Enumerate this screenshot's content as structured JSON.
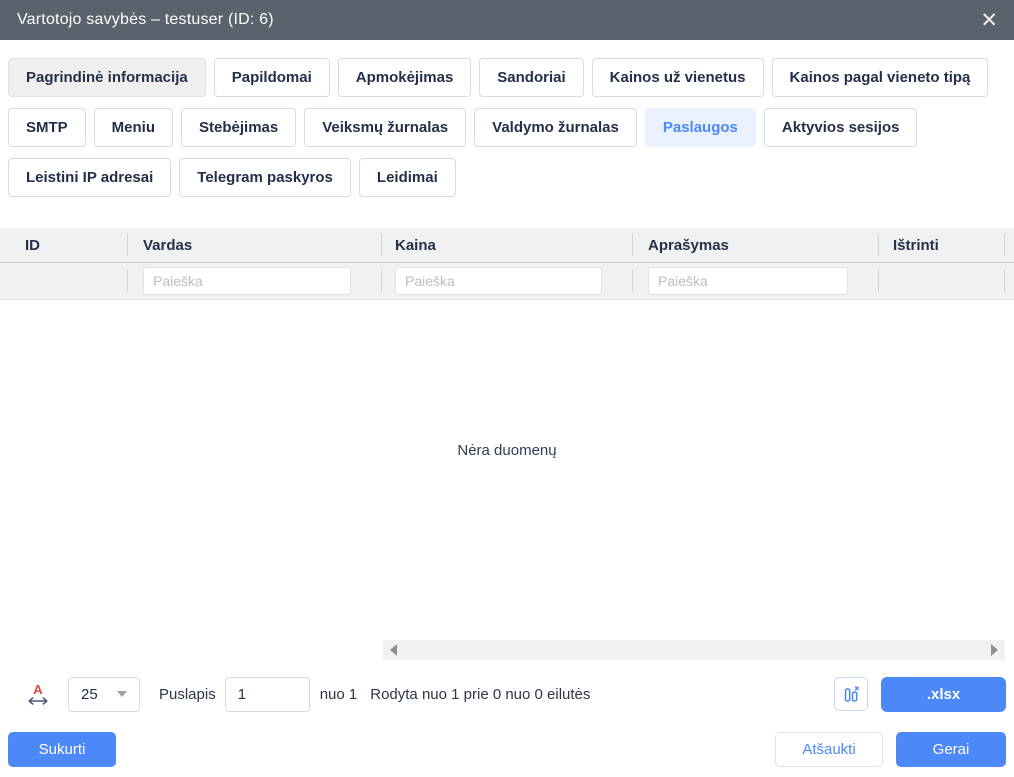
{
  "colors": {
    "accent": "#4d88f8",
    "titlebar_bg": "#5a626d",
    "active_tab_bg": "#e9f1fe",
    "active_tab_text": "#4e88f7",
    "table_header_bg": "#f0f1f3"
  },
  "titlebar": {
    "title": "Vartotojo savybės – testuser (ID: 6)",
    "close_icon": "✕"
  },
  "tabs": {
    "items": [
      {
        "label": "Pagrindinė informacija",
        "state": "pressed"
      },
      {
        "label": "Papildomai",
        "state": "normal"
      },
      {
        "label": "Apmokėjimas",
        "state": "normal"
      },
      {
        "label": "Sandoriai",
        "state": "normal"
      },
      {
        "label": "Kainos už vienetus",
        "state": "normal"
      },
      {
        "label": "Kainos pagal vieneto tipą",
        "state": "normal"
      },
      {
        "label": "SMTP",
        "state": "normal"
      },
      {
        "label": "Meniu",
        "state": "normal"
      },
      {
        "label": "Stebėjimas",
        "state": "normal"
      },
      {
        "label": "Veiksmų žurnalas",
        "state": "normal"
      },
      {
        "label": "Valdymo žurnalas",
        "state": "normal"
      },
      {
        "label": "Paslaugos",
        "state": "active"
      },
      {
        "label": "Aktyvios sesijos",
        "state": "normal"
      },
      {
        "label": "Leistini IP adresai",
        "state": "normal"
      },
      {
        "label": "Telegram paskyros",
        "state": "normal"
      },
      {
        "label": "Leidimai",
        "state": "normal"
      }
    ]
  },
  "table": {
    "columns": [
      {
        "label": "ID",
        "has_filter": false
      },
      {
        "label": "Vardas",
        "has_filter": true,
        "placeholder": "Paieška"
      },
      {
        "label": "Kaina",
        "has_filter": true,
        "placeholder": "Paieška"
      },
      {
        "label": "Aprašymas",
        "has_filter": true,
        "placeholder": "Paieška"
      },
      {
        "label": "Ištrinti",
        "has_filter": false
      }
    ],
    "empty_text": "Nėra duomenų"
  },
  "pagination": {
    "autofit_letter": "A",
    "page_size": "25",
    "page_label": "Puslapis",
    "page_value": "1",
    "page_total": "nuo 1",
    "summary": "Rodyta nuo 1 prie 0 nuo 0 eilutės",
    "export_label": ".xlsx"
  },
  "actions": {
    "create": "Sukurti",
    "cancel": "Atšaukti",
    "ok": "Gerai"
  }
}
